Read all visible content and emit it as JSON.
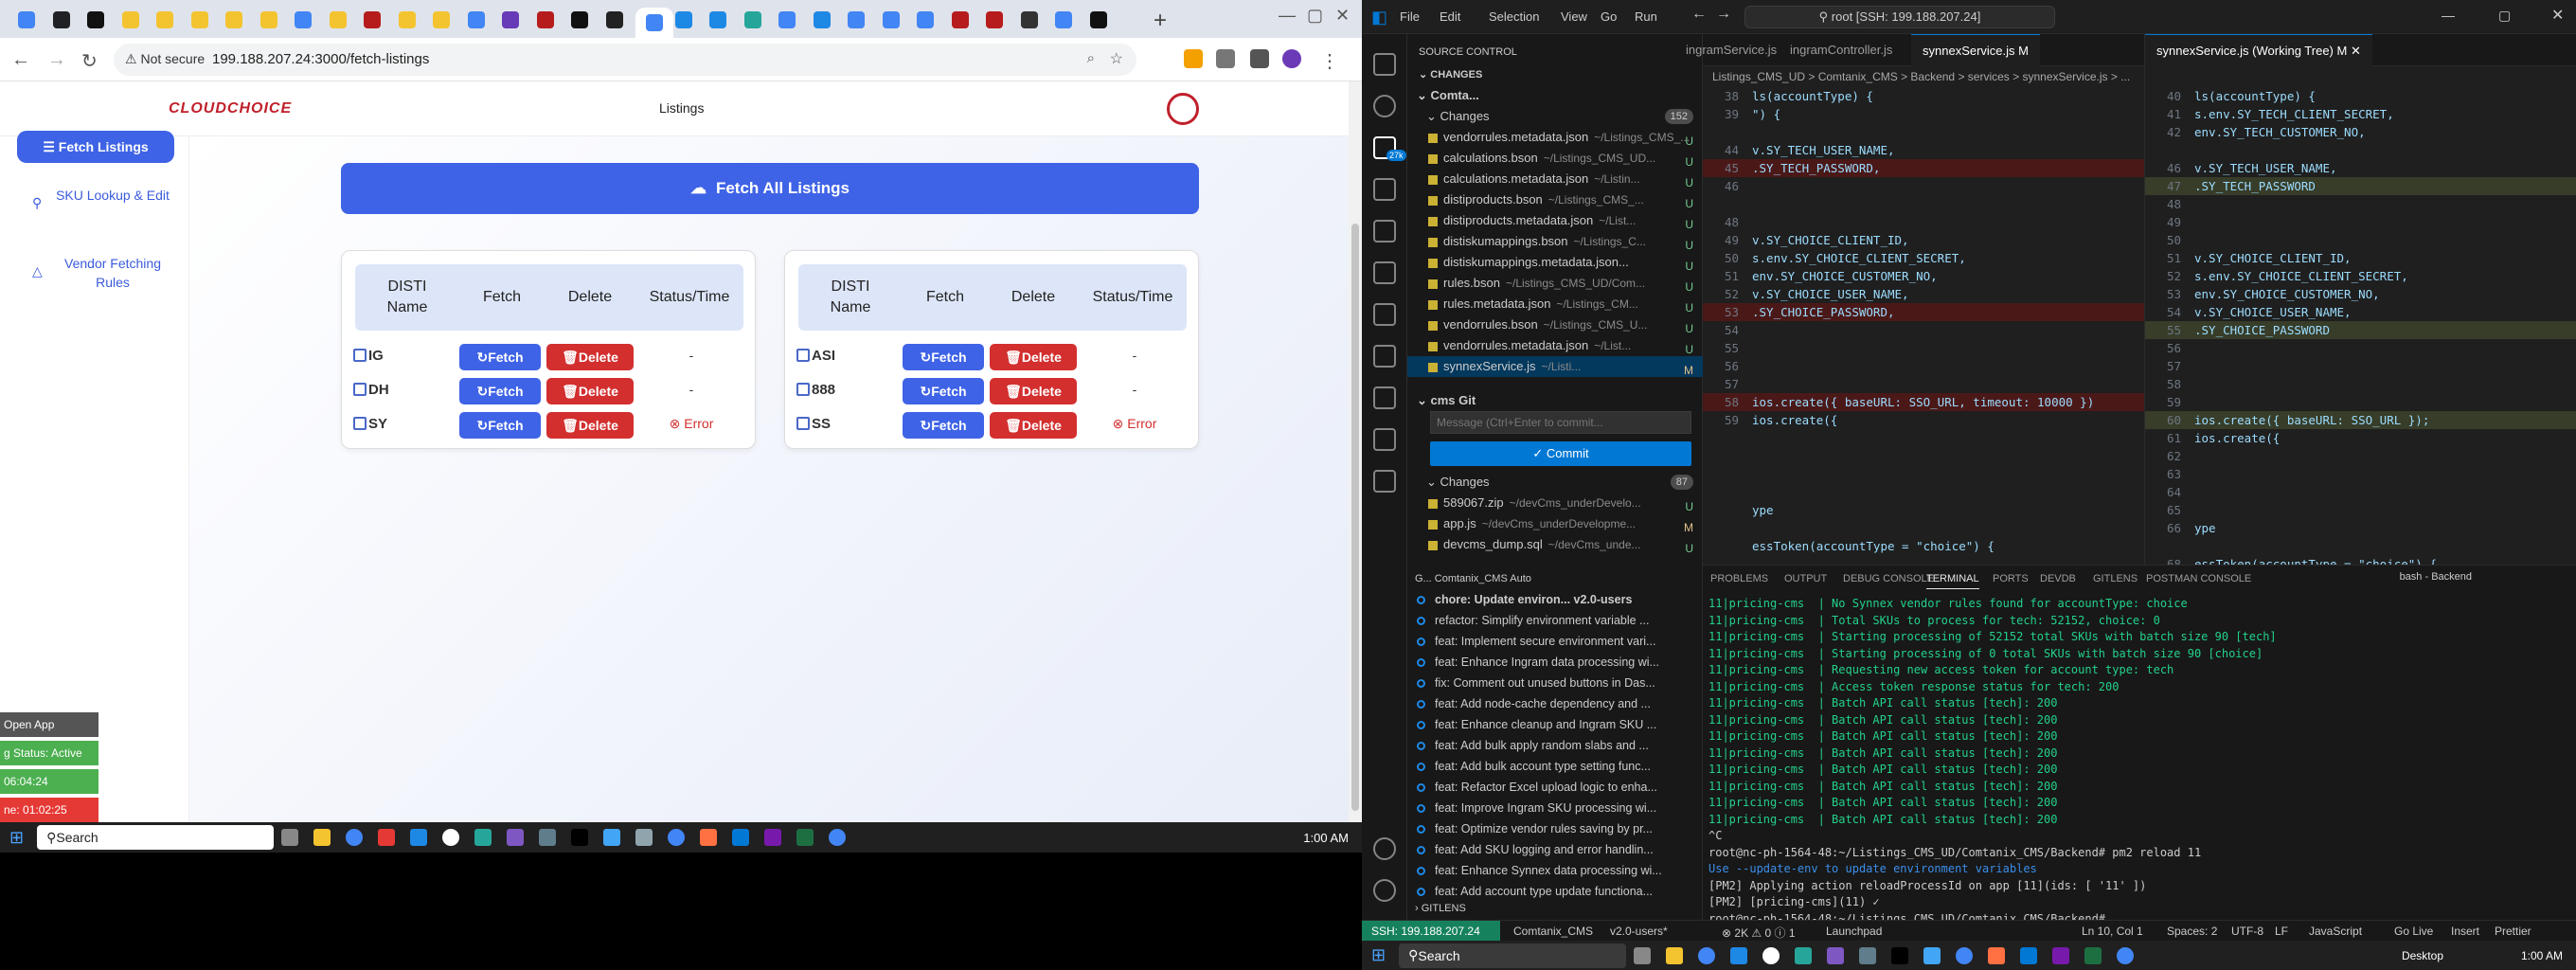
{
  "browser": {
    "url": "199.188.207.24:3000/fetch-listings",
    "security": "Not secure",
    "tab_colors": [
      "#4285f4",
      "#202124",
      "#111",
      "#f4c430",
      "#f4c430",
      "#f4c430",
      "#f4c430",
      "#f4c430",
      "#4285f4",
      "#f4c430",
      "#b71c1c",
      "#f4c430",
      "#f4c430",
      "#4285f4",
      "#673ab7",
      "#b71c1c",
      "#111",
      "#222",
      "#4285f4",
      "#1e88e5",
      "#1e88e5",
      "#26a69a",
      "#4285f4",
      "#1e88e5",
      "#4285f4",
      "#4285f4",
      "#4285f4",
      "#b71c1c",
      "#b71c1c",
      "#333",
      "#4285f4",
      "#111"
    ]
  },
  "app": {
    "logo": "CLOUDCHOICE",
    "nav_link": "Listings",
    "sidebar": [
      {
        "label": "Fetch Listings",
        "icon": "list-icon"
      },
      {
        "label": "SKU Lookup & Edit",
        "icon": "search-icon"
      },
      {
        "label": "Vendor Fetching Rules",
        "icon": "warning-icon"
      }
    ],
    "fetch_all_label": "Fetch All Listings",
    "table_headers": [
      "DISTI Name",
      "Fetch",
      "Delete",
      "Status/Time"
    ],
    "fetch_label": "Fetch",
    "delete_label": "Delete",
    "card_left": [
      {
        "name": "IG",
        "status": "-",
        "error": false
      },
      {
        "name": "DH",
        "status": "-",
        "error": false
      },
      {
        "name": "SY",
        "status": "Error",
        "error": true
      }
    ],
    "card_right": [
      {
        "name": "ASI",
        "status": "-",
        "error": false
      },
      {
        "name": "888",
        "status": "-",
        "error": false
      },
      {
        "name": "SS",
        "status": "Error",
        "error": true
      }
    ],
    "widget": {
      "open_app": "Open App",
      "status": "g Status: Active",
      "time1": "06:04:24",
      "time2": "ne: 01:02:25"
    }
  },
  "taskbar_left": {
    "search": "Search",
    "time": "1:00 AM"
  },
  "vscode": {
    "menus": [
      "File",
      "Edit",
      "Selection",
      "View",
      "Go",
      "Run"
    ],
    "command_center": "root [SSH: 199.188.207.24]",
    "scm_title": "SOURCE CONTROL",
    "changes_header": "CHANGES",
    "repo1": "Comta...",
    "changes_label": "Changes",
    "changes_count": "152",
    "files1": [
      {
        "name": "vendorrules.metadata.json",
        "path": "~/Listings_CMS_...",
        "status": "U"
      },
      {
        "name": "calculations.bson",
        "path": "~/Listings_CMS_UD...",
        "status": "U"
      },
      {
        "name": "calculations.metadata.json",
        "path": "~/Listin...",
        "status": "U"
      },
      {
        "name": "distiproducts.bson",
        "path": "~/Listings_CMS_...",
        "status": "U"
      },
      {
        "name": "distiproducts.metadata.json",
        "path": "~/List...",
        "status": "U"
      },
      {
        "name": "distiskumappings.bson",
        "path": "~/Listings_C...",
        "status": "U"
      },
      {
        "name": "distiskumappings.metadata.json...",
        "path": "",
        "status": "U"
      },
      {
        "name": "rules.bson",
        "path": "~/Listings_CMS_UD/Com...",
        "status": "U"
      },
      {
        "name": "rules.metadata.json",
        "path": "~/Listings_CM...",
        "status": "U"
      },
      {
        "name": "vendorrules.bson",
        "path": "~/Listings_CMS_U...",
        "status": "U"
      },
      {
        "name": "vendorrules.metadata.json",
        "path": "~/List...",
        "status": "U"
      },
      {
        "name": "synnexService.js",
        "path": "~/Listi...",
        "status": "M"
      }
    ],
    "repo2": "cms Git",
    "commit_placeholder": "Message (Ctrl+Enter to commit...",
    "commit_label": "Commit",
    "changes2_count": "87",
    "files2": [
      {
        "name": "589067.zip",
        "path": "~/devCms_underDevelo...",
        "status": "U"
      },
      {
        "name": "app.js",
        "path": "~/devCms_underDevelopme...",
        "status": "M"
      },
      {
        "name": "devcms_dump.sql",
        "path": "~/devCms_unde...",
        "status": "U"
      }
    ],
    "editor_tabs_left": [
      "ingramService.js",
      "ingramController.js",
      "synnexService.js M"
    ],
    "editor_tab_right": "synnexService.js (Working Tree) M",
    "breadcrumb": "Listings_CMS_UD > Comtanix_CMS > Backend > services > synnexService.js > ...",
    "code_left": [
      {
        "n": "38",
        "t": "ls(accountType) {",
        "k": ""
      },
      {
        "n": "39",
        "t": "\") {",
        "k": ""
      },
      {
        "n": "",
        "t": "",
        "k": ""
      },
      {
        "n": "44",
        "t": "v.SY_TECH_USER_NAME,",
        "k": ""
      },
      {
        "n": "45",
        "t": ".SY_TECH_PASSWORD,",
        "k": "del"
      },
      {
        "n": "46",
        "t": "",
        "k": ""
      },
      {
        "n": "",
        "t": "",
        "k": ""
      },
      {
        "n": "48",
        "t": "",
        "k": ""
      },
      {
        "n": "49",
        "t": "v.SY_CHOICE_CLIENT_ID,",
        "k": ""
      },
      {
        "n": "50",
        "t": "s.env.SY_CHOICE_CLIENT_SECRET,",
        "k": ""
      },
      {
        "n": "51",
        "t": "env.SY_CHOICE_CUSTOMER_NO,",
        "k": ""
      },
      {
        "n": "52",
        "t": "v.SY_CHOICE_USER_NAME,",
        "k": ""
      },
      {
        "n": "53",
        "t": ".SY_CHOICE_PASSWORD,",
        "k": "del"
      },
      {
        "n": "54",
        "t": "",
        "k": ""
      },
      {
        "n": "55",
        "t": "",
        "k": ""
      },
      {
        "n": "56",
        "t": "",
        "k": ""
      },
      {
        "n": "57",
        "t": "",
        "k": ""
      },
      {
        "n": "58",
        "t": "ios.create({ baseURL: SSO_URL, timeout: 10000 })",
        "k": "del"
      },
      {
        "n": "59",
        "t": "ios.create({",
        "k": ""
      },
      {
        "n": "",
        "t": "",
        "k": ""
      },
      {
        "n": "",
        "t": "",
        "k": ""
      },
      {
        "n": "",
        "t": "",
        "k": ""
      },
      {
        "n": "",
        "t": "",
        "k": ""
      },
      {
        "n": "",
        "t": "ype",
        "k": ""
      },
      {
        "n": "",
        "t": "",
        "k": ""
      },
      {
        "n": "",
        "t": "essToken(accountType = \"choice\") {",
        "k": ""
      }
    ],
    "code_right": [
      {
        "n": "40",
        "t": "ls(accountType) {",
        "k": ""
      },
      {
        "n": "41",
        "t": "s.env.SY_TECH_CLIENT_SECRET,",
        "k": ""
      },
      {
        "n": "42",
        "t": "env.SY_TECH_CUSTOMER_NO,",
        "k": ""
      },
      {
        "n": "",
        "t": "",
        "k": ""
      },
      {
        "n": "46",
        "t": "v.SY_TECH_USER_NAME,",
        "k": ""
      },
      {
        "n": "47",
        "t": ".SY_TECH_PASSWORD",
        "k": "add"
      },
      {
        "n": "48",
        "t": "",
        "k": ""
      },
      {
        "n": "49",
        "t": "",
        "k": ""
      },
      {
        "n": "50",
        "t": "",
        "k": ""
      },
      {
        "n": "51",
        "t": "v.SY_CHOICE_CLIENT_ID,",
        "k": ""
      },
      {
        "n": "52",
        "t": "s.env.SY_CHOICE_CLIENT_SECRET,",
        "k": ""
      },
      {
        "n": "53",
        "t": "env.SY_CHOICE_CUSTOMER_NO,",
        "k": ""
      },
      {
        "n": "54",
        "t": "v.SY_CHOICE_USER_NAME,",
        "k": ""
      },
      {
        "n": "55",
        "t": ".SY_CHOICE_PASSWORD",
        "k": "add"
      },
      {
        "n": "56",
        "t": "",
        "k": ""
      },
      {
        "n": "57",
        "t": "",
        "k": ""
      },
      {
        "n": "58",
        "t": "",
        "k": ""
      },
      {
        "n": "59",
        "t": "",
        "k": ""
      },
      {
        "n": "60",
        "t": "ios.create({ baseURL: SSO_URL });",
        "k": "add"
      },
      {
        "n": "61",
        "t": "ios.create({",
        "k": ""
      },
      {
        "n": "62",
        "t": "",
        "k": ""
      },
      {
        "n": "63",
        "t": "",
        "k": ""
      },
      {
        "n": "64",
        "t": "",
        "k": ""
      },
      {
        "n": "65",
        "t": "",
        "k": ""
      },
      {
        "n": "66",
        "t": "ype",
        "k": ""
      },
      {
        "n": "",
        "t": "",
        "k": ""
      },
      {
        "n": "68",
        "t": "essToken(accountType = \"choice\") {",
        "k": ""
      }
    ],
    "panel_tabs": [
      "PROBLEMS",
      "OUTPUT",
      "DEBUG CONSOLE",
      "TERMINAL",
      "PORTS",
      "DEVDB",
      "GITLENS",
      "POSTMAN CONSOLE"
    ],
    "terminal_shell": "bash - Backend",
    "terminal": [
      "11|pricing-cms  | No Synnex vendor rules found for accountType: choice",
      "11|pricing-cms  | Total SKUs to process for tech: 52152, choice: 0",
      "11|pricing-cms  | Starting processing of 52152 total SKUs with batch size 90 [tech]",
      "11|pricing-cms  | Starting processing of 0 total SKUs with batch size 90 [choice]",
      "11|pricing-cms  | Requesting new access token for account type: tech",
      "11|pricing-cms  | Access token response status for tech: 200",
      "11|pricing-cms  | Batch API call status [tech]: 200",
      "11|pricing-cms  | Batch API call status [tech]: 200",
      "11|pricing-cms  | Batch API call status [tech]: 200",
      "11|pricing-cms  | Batch API call status [tech]: 200",
      "11|pricing-cms  | Batch API call status [tech]: 200",
      "11|pricing-cms  | Batch API call status [tech]: 200",
      "11|pricing-cms  | Batch API call status [tech]: 200",
      "11|pricing-cms  | Batch API call status [tech]: 200",
      "^C",
      "root@nc-ph-1564-48:~/Listings_CMS_UD/Comtanix_CMS/Backend# pm2 reload 11",
      "Use --update-env to update environment variables",
      "[PM2] Applying action reloadProcessId on app [11](ids: [ '11' ])",
      "[PM2] [pricing-cms](11) ✓",
      "root@nc-ph-1564-48:~/Listings_CMS_UD/Comtanix_CMS/Backend# "
    ],
    "graph_header": "G... Comtanix_CMS  Auto",
    "commits": [
      "chore: Update environ...  v2.0-users",
      "refactor: Simplify environment variable ...",
      "feat: Implement secure environment vari...",
      "feat: Enhance Ingram data processing wi...",
      "fix: Comment out unused buttons in Das...",
      "feat: Add node-cache dependency and ...",
      "feat: Enhance cleanup and Ingram SKU ...",
      "feat: Add bulk apply random slabs and ...",
      "feat: Add bulk account type setting func...",
      "feat: Refactor Excel upload logic to enha...",
      "feat: Improve Ingram SKU processing wi...",
      "feat: Optimize vendor rules saving by pr...",
      "feat: Add SKU logging and error handlin...",
      "feat: Enhance Synnex data processing wi...",
      "feat: Add account type update functiona..."
    ],
    "gitlens": "GITLENS",
    "statusbar": {
      "remote": "SSH: 199.188.207.24",
      "branch": "Comtanix_CMS",
      "tag": "v2.0-users*",
      "errors": "2K",
      "warn": "0",
      "info": "1",
      "launchpad": "Launchpad",
      "position": "Ln 10, Col 1",
      "spaces": "Spaces: 2",
      "encoding": "UTF-8",
      "eol": "LF",
      "lang": "JavaScript",
      "golive": "Go Live",
      "insert": "Insert",
      "prettier": "Prettier"
    },
    "taskbar": {
      "search": "Search",
      "time": "1:00 AM",
      "desktop": "Desktop"
    }
  }
}
